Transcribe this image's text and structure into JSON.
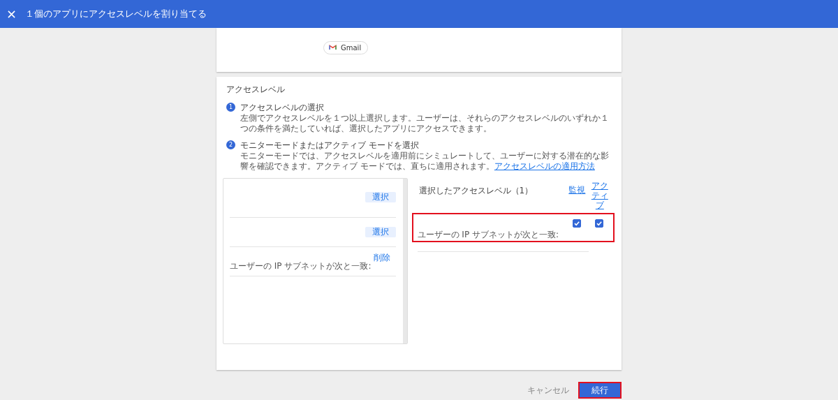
{
  "header": {
    "title": "１個のアプリにアクセスレベルを割り当てる"
  },
  "app_chip": {
    "label": "Gmail"
  },
  "access_level": {
    "title": "アクセスレベル",
    "steps": [
      {
        "number": "1",
        "title": "アクセスレベルの選択",
        "description": "左側でアクセスレベルを１つ以上選択します。ユーザーは、それらのアクセスレベルのいずれか１つの条件を満たしていれば、選択したアプリにアクセスできます。"
      },
      {
        "number": "2",
        "title": "モニターモードまたはアクティブ モードを選択",
        "description": "モニターモードでは、アクセスレベルを適用前にシミュレートして、ユーザーに対する潜在的な影響を確認できます。アクティブ モードでは、直ちに適用されます。",
        "link": "アクセスレベルの適用方法"
      }
    ]
  },
  "available_levels": {
    "rows": [
      {
        "kind": "select",
        "button": "選択"
      },
      {
        "kind": "select",
        "button": "選択"
      },
      {
        "kind": "remove",
        "label": "ユーザーの IP サブネットが次と一致:",
        "button": "削除"
      }
    ]
  },
  "selected_levels": {
    "heading": "選択したアクセスレベル（1）",
    "columns": [
      "監視",
      "アクティブ"
    ],
    "rows": [
      {
        "label": "ユーザーの IP サブネットが次と一致:",
        "monitor": true,
        "active": true,
        "highlighted": true
      }
    ]
  },
  "footer": {
    "cancel": "キャンセル",
    "continue": "続行",
    "continue_highlighted": true
  }
}
